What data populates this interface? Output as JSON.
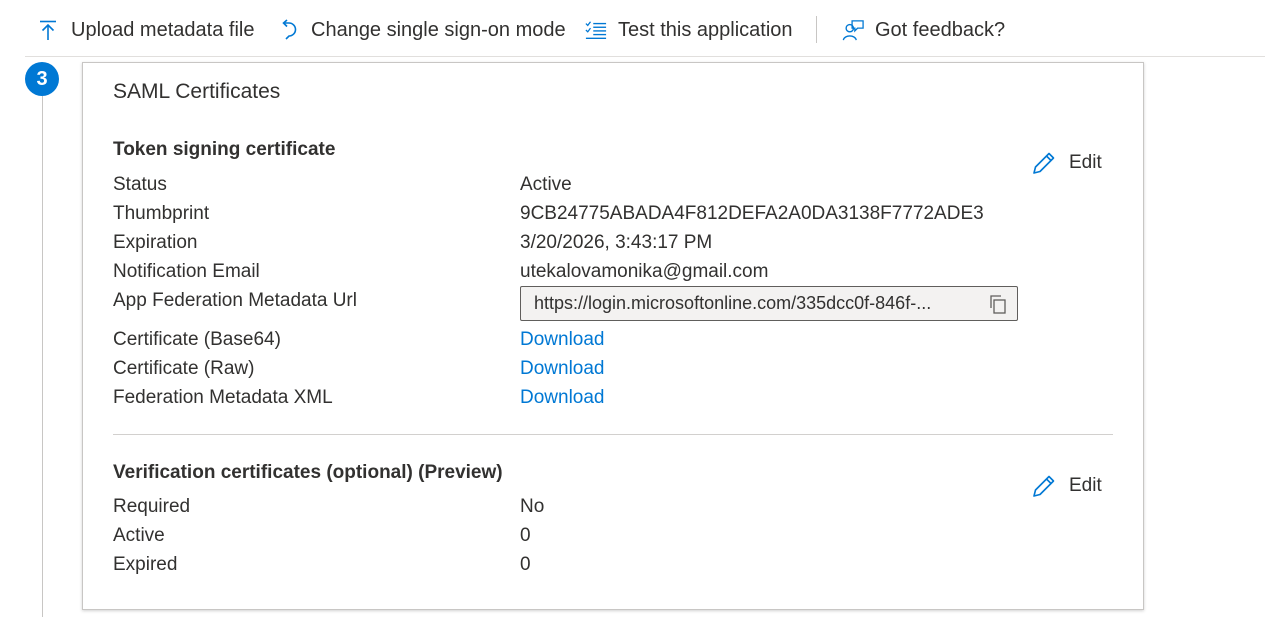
{
  "toolbar": {
    "upload_label": "Upload metadata file",
    "change_sso_label": "Change single sign-on mode",
    "test_label": "Test this application",
    "feedback_label": "Got feedback?"
  },
  "step": {
    "number": "3"
  },
  "card": {
    "title": "SAML Certificates",
    "token_section": {
      "title": "Token signing certificate",
      "edit_label": "Edit",
      "status_label": "Status",
      "status_value": "Active",
      "thumbprint_label": "Thumbprint",
      "thumbprint_value": "9CB24775ABADA4F812DEFA2A0DA3138F7772ADE3",
      "expiration_label": "Expiration",
      "expiration_value": "3/20/2026, 3:43:17 PM",
      "email_label": "Notification Email",
      "email_value": "utekalovamonika@gmail.com",
      "metadata_url_label": "App Federation Metadata Url",
      "metadata_url_value": "https://login.microsoftonline.com/335dcc0f-846f-...",
      "cert_base64_label": "Certificate (Base64)",
      "cert_base64_link": "Download",
      "cert_raw_label": "Certificate (Raw)",
      "cert_raw_link": "Download",
      "fed_xml_label": "Federation Metadata XML",
      "fed_xml_link": "Download"
    },
    "verification_section": {
      "title": "Verification certificates (optional) (Preview)",
      "edit_label": "Edit",
      "required_label": "Required",
      "required_value": "No",
      "active_label": "Active",
      "active_value": "0",
      "expired_label": "Expired",
      "expired_value": "0"
    }
  },
  "colors": {
    "accent": "#0078d4",
    "text": "#323130",
    "border": "#c8c6c4"
  },
  "icons": {
    "upload": "upload-arrow-icon",
    "change_sso": "undo-arrow-icon",
    "test": "checklist-icon",
    "feedback": "feedback-person-icon",
    "edit": "pencil-icon",
    "copy": "copy-icon"
  }
}
